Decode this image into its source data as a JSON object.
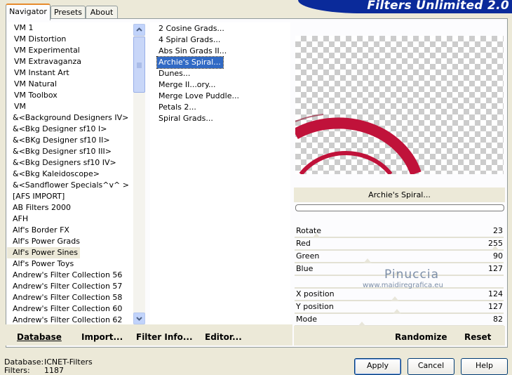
{
  "banner": {
    "title": "Filters Unlimited 2.0"
  },
  "tabs": [
    {
      "label": "Navigator",
      "active": true
    },
    {
      "label": "Presets",
      "active": false
    },
    {
      "label": "About",
      "active": false
    }
  ],
  "categories": [
    "VM 1",
    "VM Distortion",
    "VM Experimental",
    "VM Extravaganza",
    "VM Instant Art",
    "VM Natural",
    "VM Toolbox",
    "VM",
    "&<Background Designers IV>",
    "&<Bkg Designer sf10 I>",
    "&<BKg Designer sf10 II>",
    "&<Bkg Designer sf10 III>",
    "&<Bkg Designers sf10 IV>",
    "&<Bkg Kaleidoscope>",
    "&<Sandflower Specials^v^ >",
    "[AFS IMPORT]",
    "AB Filters 2000",
    "AFH",
    "Alf's Border FX",
    "Alf's Power Grads",
    "Alf's Power Sines",
    "Alf's Power Toys",
    "Andrew's Filter Collection 56",
    "Andrew's Filter Collection 57",
    "Andrew's Filter Collection 58",
    "Andrew's Filter Collection 60",
    "Andrew's Filter Collection 62"
  ],
  "filters": [
    "2 Cosine Grads...",
    "4 Spiral Grads...",
    "Abs Sin Grads II...",
    "Archie's Spiral...",
    "Dunes...",
    "Merge II...ory...",
    "Merge Love Puddle...",
    "Petals 2...",
    "Spiral Grads..."
  ],
  "selected_filter": "Archie's Spiral...",
  "preview": {
    "title": "Archie's Spiral...",
    "spiral_color": "#C0123A"
  },
  "params": [
    {
      "label": "Rotate",
      "value": "23",
      "level": 0.09
    },
    {
      "label": "Red",
      "value": "255",
      "level": 1.0
    },
    {
      "label": "Green",
      "value": "90",
      "level": 0.35
    },
    {
      "label": "Blue",
      "value": "127",
      "level": 0.5
    },
    {
      "label": "",
      "value": "",
      "level": null
    },
    {
      "label": "X position",
      "value": "124",
      "level": 0.49
    },
    {
      "label": "Y position",
      "value": "127",
      "level": 0.5
    },
    {
      "label": "Mode",
      "value": "82",
      "level": 0.32
    }
  ],
  "watermark": {
    "line1": "Pinuccia",
    "line2": "www.maidiregrafica.eu"
  },
  "bottom_links": {
    "database": "Database",
    "import": "Import...",
    "filter_info": "Filter Info...",
    "editor": "Editor..."
  },
  "preview_actions": {
    "randomize": "Randomize",
    "reset": "Reset"
  },
  "status": {
    "database_label": "Database:",
    "database_value": "ICNET-Filters",
    "filters_label": "Filters:",
    "filters_value": "1187"
  },
  "dialog_buttons": {
    "apply": "Apply",
    "cancel": "Cancel",
    "help": "Help"
  }
}
